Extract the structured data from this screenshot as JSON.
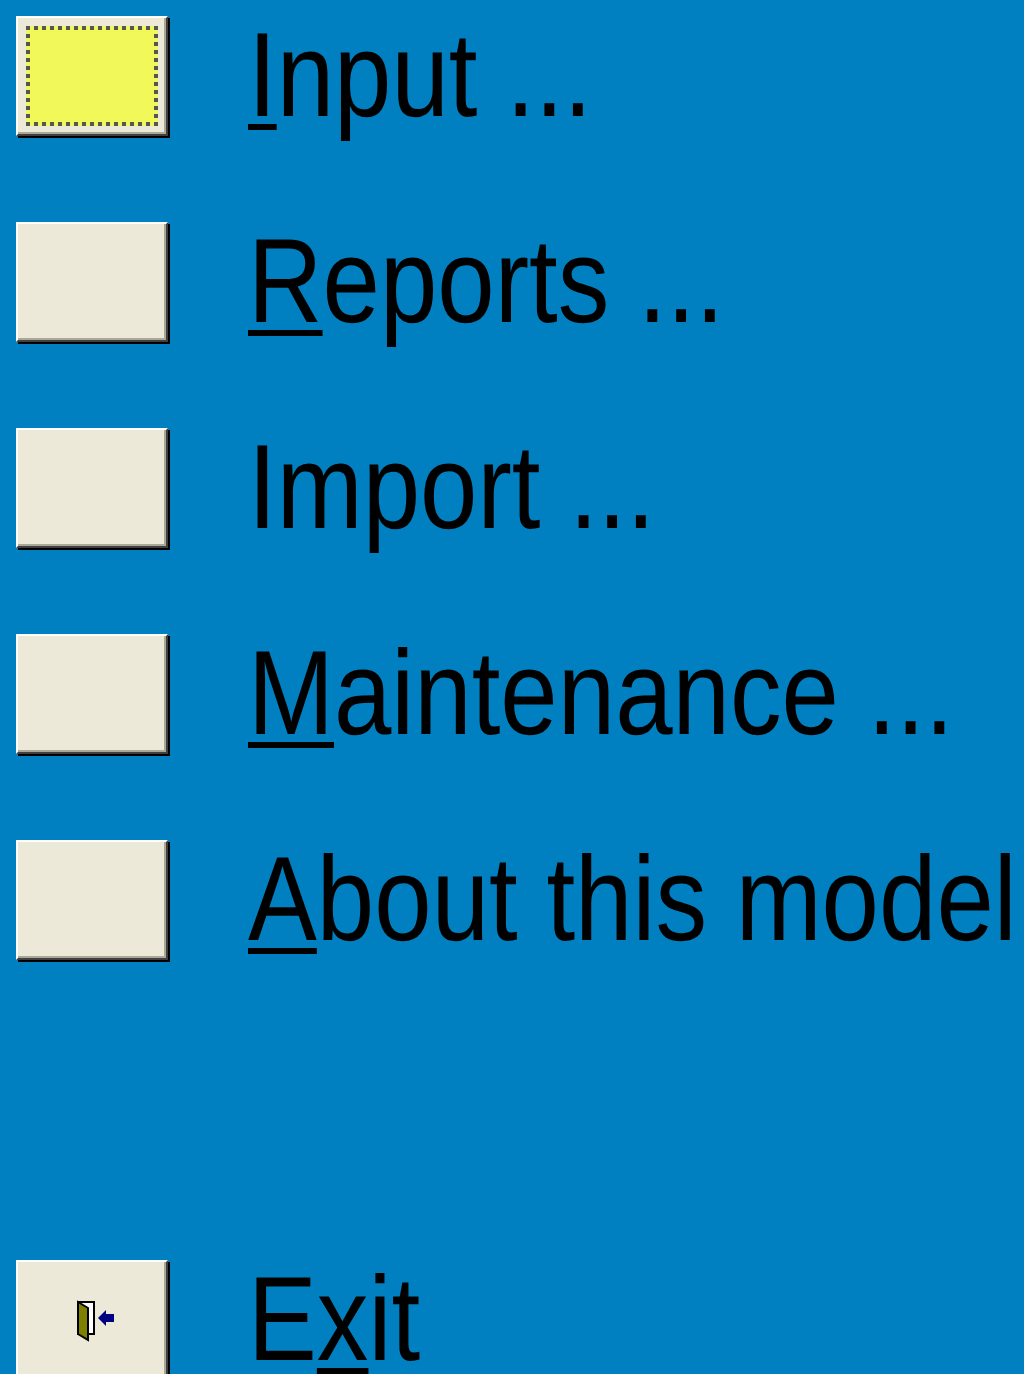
{
  "menu": [
    {
      "focused": true,
      "label": {
        "key": "I",
        "after": "nput ..."
      }
    },
    {
      "focused": false,
      "label": {
        "key": "R",
        "after": "eports ..."
      }
    },
    {
      "focused": false,
      "label": {
        "before": "Import ..."
      }
    },
    {
      "focused": false,
      "label": {
        "key": "M",
        "after": "aintenance ..."
      }
    },
    {
      "focused": false,
      "label": {
        "key": "A",
        "after": "bout this model"
      }
    }
  ],
  "exit": {
    "focused": false,
    "label": {
      "before": "E",
      "key": "x",
      "after": "it"
    }
  }
}
